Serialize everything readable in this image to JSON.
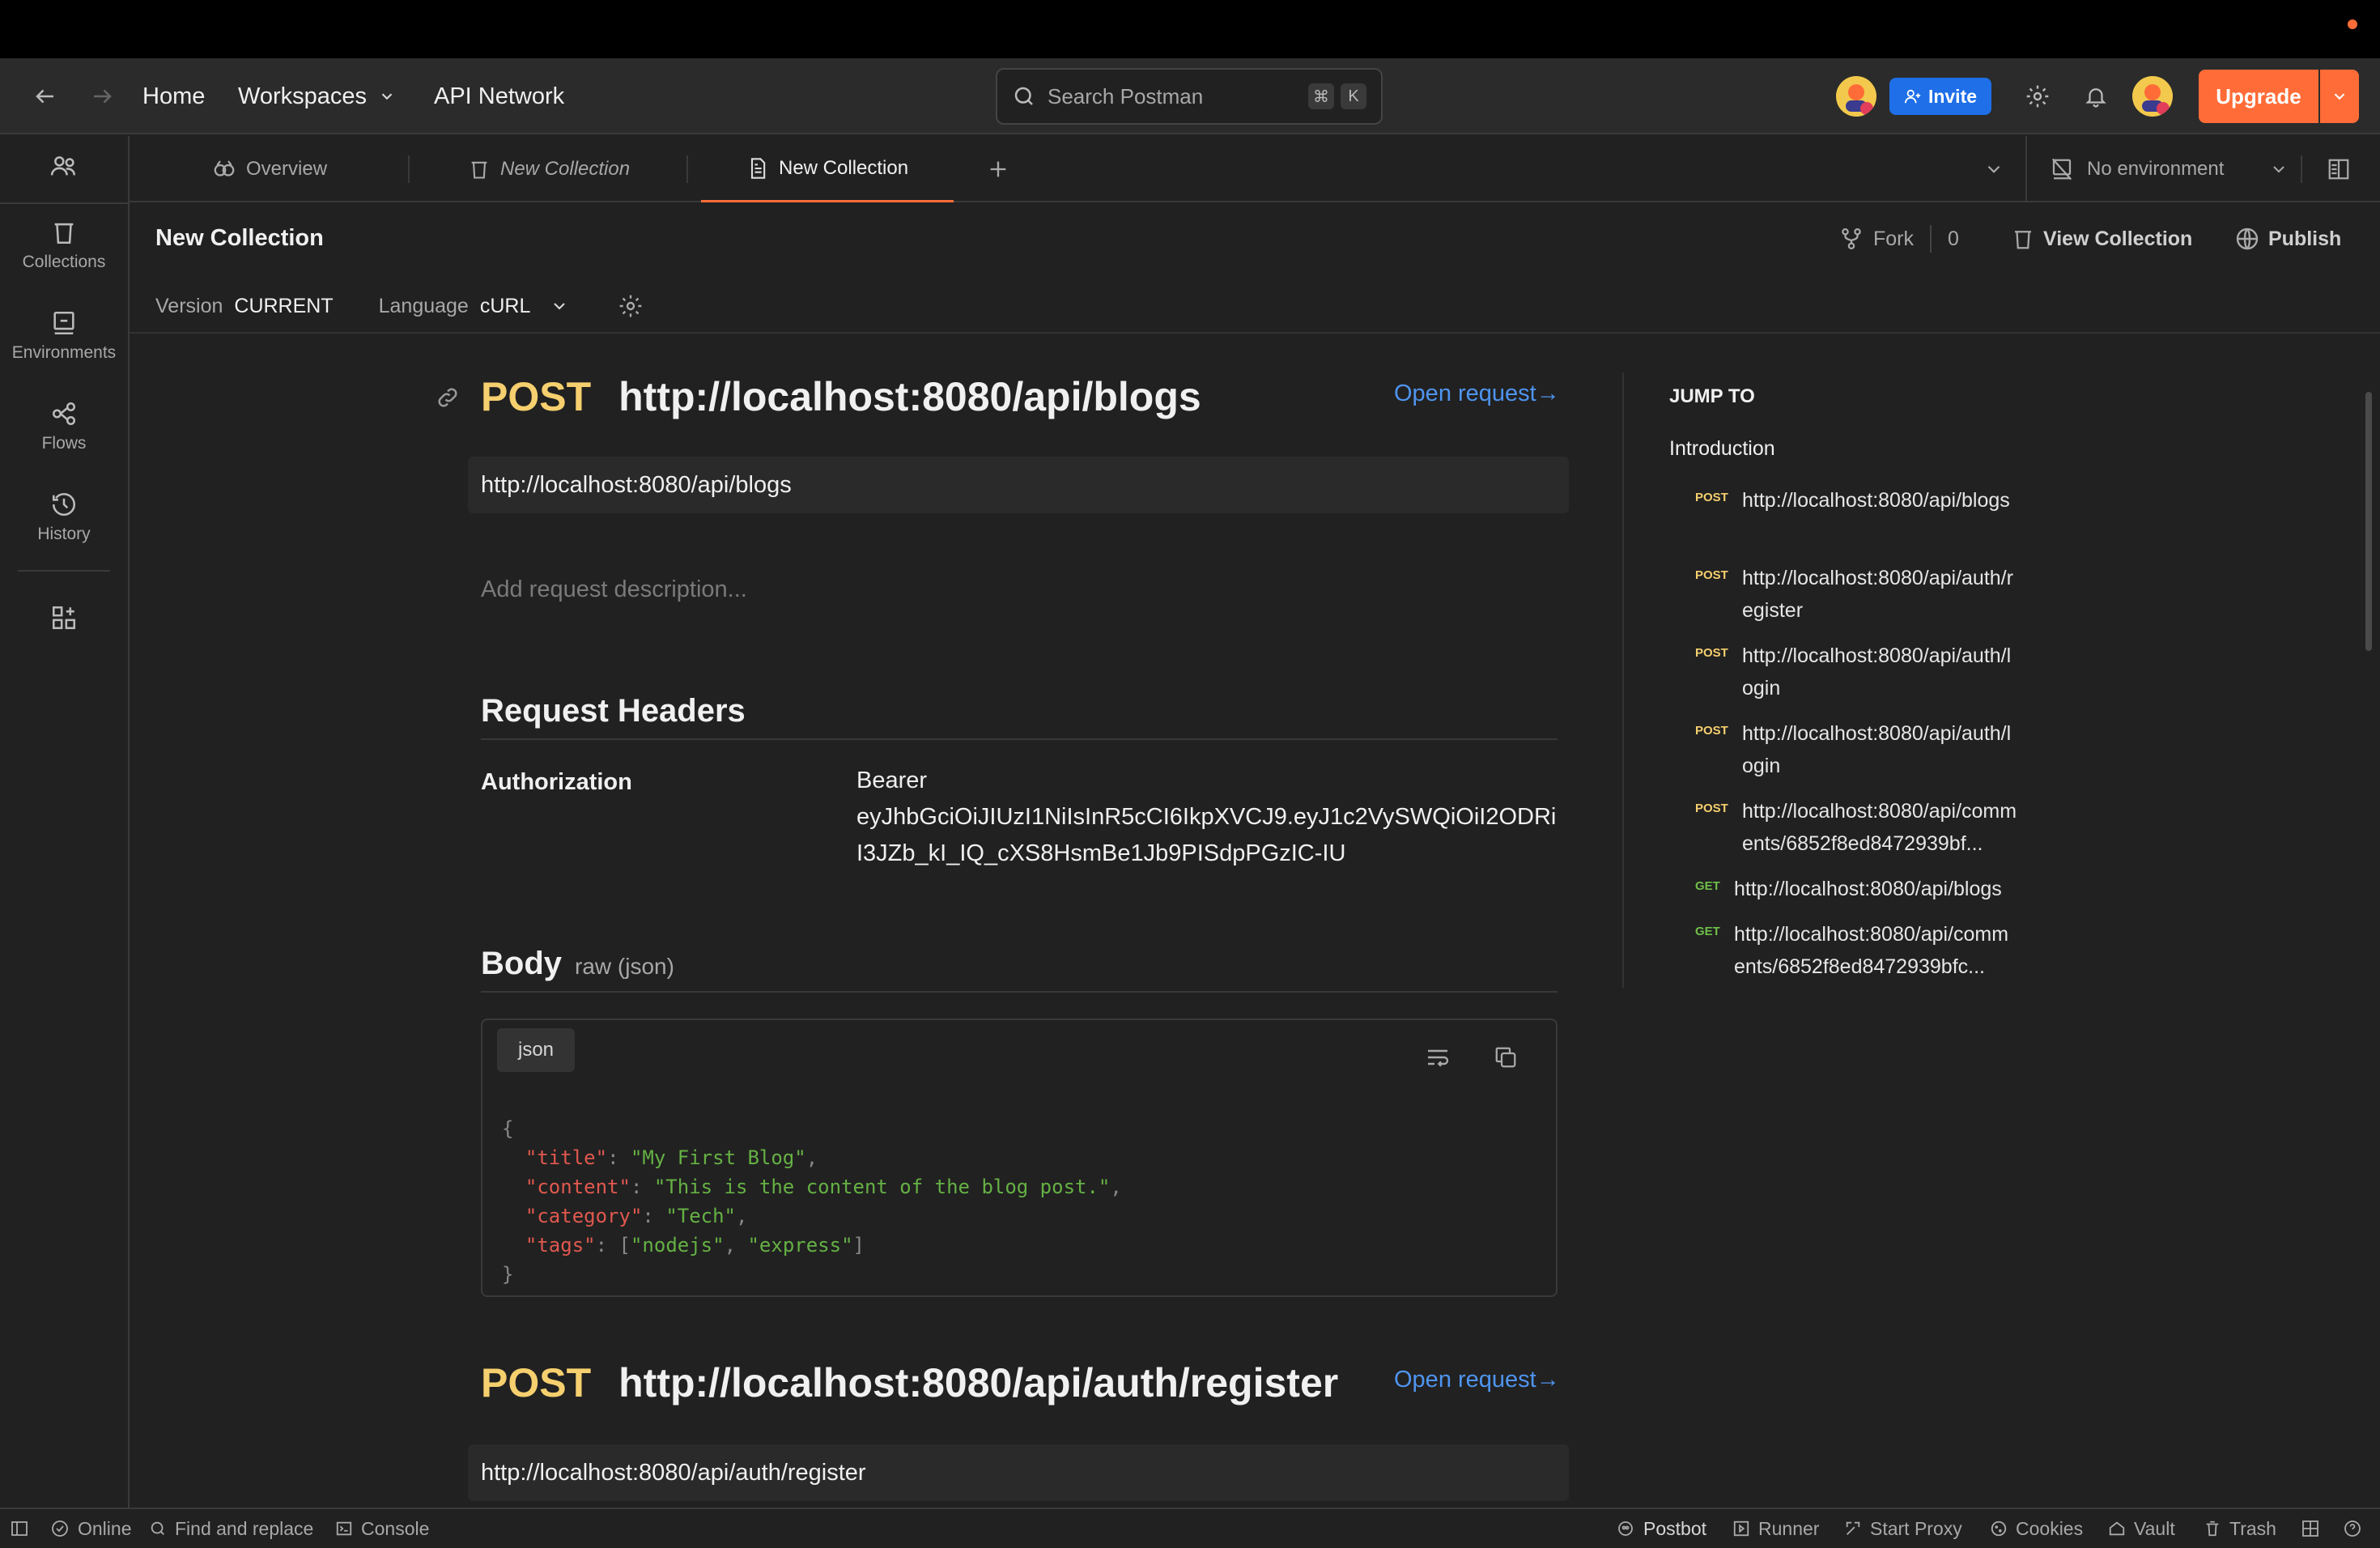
{
  "header": {
    "nav": {
      "home": "Home",
      "workspaces": "Workspaces",
      "api_network": "API Network"
    },
    "search": {
      "placeholder": "Search Postman",
      "shortcut_cmd": "⌘",
      "shortcut_key": "K"
    },
    "invite_label": "Invite",
    "upgrade_label": "Upgrade"
  },
  "sidebar": {
    "items": [
      {
        "label": "Collections",
        "icon": "trash-can-icon"
      },
      {
        "label": "Environments",
        "icon": "environment-icon"
      },
      {
        "label": "Flows",
        "icon": "flows-icon"
      },
      {
        "label": "History",
        "icon": "history-icon"
      }
    ]
  },
  "tabs": {
    "items": [
      {
        "label": "Overview"
      },
      {
        "label": "New Collection"
      },
      {
        "label": "New Collection"
      }
    ],
    "environment": "No environment"
  },
  "collection": {
    "title": "New Collection",
    "fork_label": "Fork",
    "fork_count": "0",
    "view_label": "View Collection",
    "publish_label": "Publish",
    "version_label": "Version",
    "version_value": "CURRENT",
    "language_label": "Language",
    "language_value": "cURL"
  },
  "request1": {
    "method": "POST",
    "url": "http://localhost:8080/api/blogs",
    "open_label": "Open request→",
    "description_placeholder": "Add request description...",
    "headers_title": "Request Headers",
    "header_key": "Authorization",
    "header_value_1": "Bearer",
    "header_value_2": "eyJhbGciOiJIUzI1NiIsInR5cCI6IkpXVCJ9.eyJ1c2VySWQiOiI2ODRiN",
    "header_value_3": "I3JZb_kI_IQ_cXS8HsmBe1Jb9PISdpPGzIC-IU",
    "body_title": "Body",
    "body_type": "raw (json)",
    "code_lang": "json",
    "body_fields": {
      "title_key": "\"title\"",
      "title_val": "\"My First Blog\"",
      "content_key": "\"content\"",
      "content_val": "\"This is the content of the blog post.\"",
      "category_key": "\"category\"",
      "category_val": "\"Tech\"",
      "tags_key": "\"tags\"",
      "tag1": "\"nodejs\"",
      "tag2": "\"express\""
    }
  },
  "request2": {
    "method": "POST",
    "url": "http://localhost:8080/api/auth/register",
    "open_label": "Open request→"
  },
  "jump_to": {
    "title": "JUMP TO",
    "intro": "Introduction",
    "items": [
      {
        "method": "POST",
        "text": "http://localhost:8080/api/blogs"
      },
      {
        "method": "POST",
        "text": "http://localhost:8080/api/auth/register"
      },
      {
        "method": "POST",
        "text": "http://localhost:8080/api/auth/login"
      },
      {
        "method": "POST",
        "text": "http://localhost:8080/api/auth/login"
      },
      {
        "method": "POST",
        "text": "http://localhost:8080/api/comments/6852f8ed8472939bf..."
      },
      {
        "method": "GET",
        "text": "http://localhost:8080/api/blogs"
      },
      {
        "method": "GET",
        "text": "http://localhost:8080/api/comments/6852f8ed8472939bfc..."
      }
    ]
  },
  "footer": {
    "online": "Online",
    "find_replace": "Find and replace",
    "console": "Console",
    "postbot": "Postbot",
    "runner": "Runner",
    "start_proxy": "Start Proxy",
    "cookies": "Cookies",
    "vault": "Vault",
    "trash": "Trash"
  },
  "colors": {
    "accent": "#ff6c37",
    "invite": "#1e6fe8",
    "method_post": "#f6cf6e",
    "method_get": "#6fbf4a",
    "link": "#4f94ef"
  }
}
